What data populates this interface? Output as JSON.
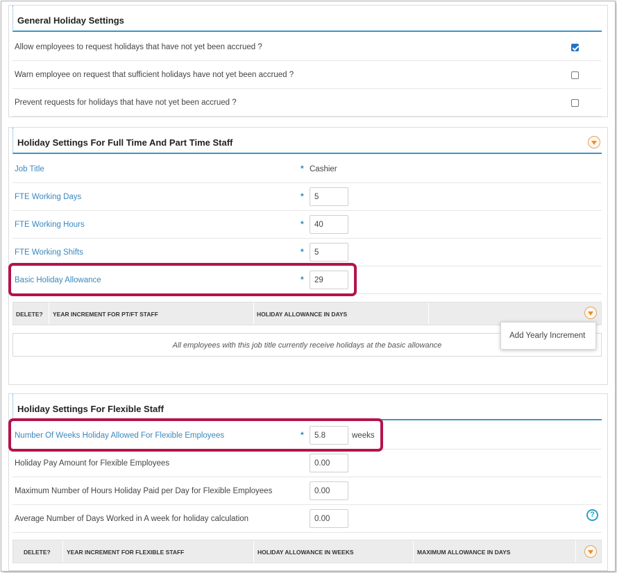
{
  "general": {
    "title": "General Holiday Settings",
    "rows": [
      {
        "label": "Allow employees to request holidays that have not yet been accrued ?",
        "checked": true
      },
      {
        "label": "Warn employee on request that sufficient holidays have not yet been accrued ?",
        "checked": false
      },
      {
        "label": "Prevent requests for holidays that have not yet been accrued ?",
        "checked": false
      }
    ]
  },
  "fulltime": {
    "title": "Holiday Settings For Full Time And Part Time Staff",
    "required_mark": "*",
    "job_title_label": "Job Title",
    "job_title_value": "Cashier",
    "fte_days_label": "FTE Working Days",
    "fte_days_value": "5",
    "fte_hours_label": "FTE Working Hours",
    "fte_hours_value": "40",
    "fte_shifts_label": "FTE Working Shifts",
    "fte_shifts_value": "5",
    "basic_allowance_label": "Basic Holiday Allowance",
    "basic_allowance_value": "29",
    "table": {
      "col_delete": "DELETE?",
      "col_year": "YEAR INCREMENT FOR PT/FT STAFF",
      "col_allowance": "HOLIDAY ALLOWANCE IN DAYS",
      "empty_message": "All employees with this job title currently receive holidays at the basic allowance"
    },
    "menu_item": "Add Yearly Increment"
  },
  "flexible": {
    "title": "Holiday Settings For Flexible Staff",
    "required_mark": "*",
    "weeks_label": "Number Of Weeks Holiday Allowed For Flexible Employees",
    "weeks_value": "5.8",
    "weeks_suffix": "weeks",
    "pay_label": "Holiday Pay Amount for Flexible Employees",
    "pay_value": "0.00",
    "max_hours_label": "Maximum Number of Hours Holiday Paid per Day for Flexible Employees",
    "max_hours_value": "0.00",
    "avg_days_label": "Average Number of Days Worked in A week for holiday calculation",
    "avg_days_value": "0.00",
    "help_glyph": "?",
    "table": {
      "col_delete": "DELETE?",
      "col_year": "YEAR INCREMENT FOR FLEXIBLE STAFF",
      "col_weeks": "HOLIDAY ALLOWANCE IN WEEKS",
      "col_max": "MAXIMUM ALLOWANCE IN DAYS"
    }
  },
  "colors": {
    "accent_blue": "#3d94c8",
    "label_blue": "#3a87bd",
    "highlight": "#b4134c",
    "toggle_orange": "#e8902f",
    "checkbox_blue": "#2470c9"
  }
}
